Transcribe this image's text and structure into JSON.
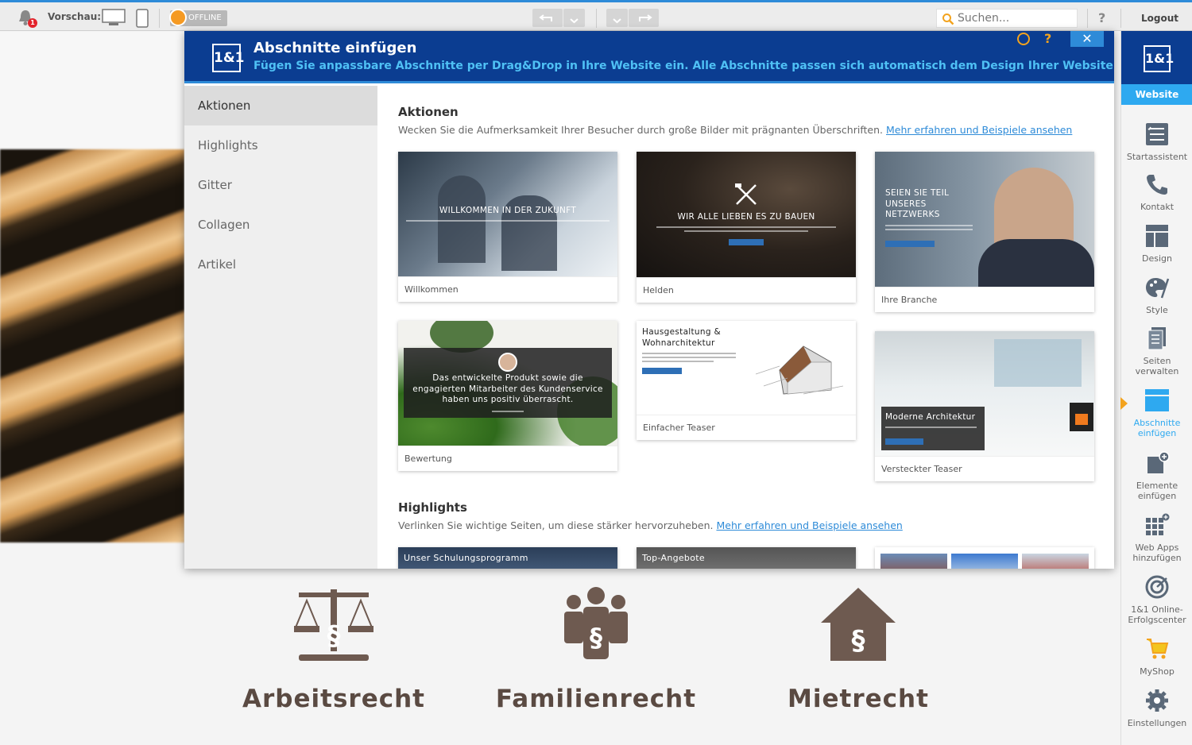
{
  "toolbar": {
    "notification_count": "1",
    "preview_label": "Vorschau:",
    "offline_label": "OFFLINE",
    "search_placeholder": "Suchen...",
    "help_label": "?",
    "logout_label": "Logout"
  },
  "dialog": {
    "logo": "1&1",
    "title": "Abschnitte einfügen",
    "subtitle": "Fügen Sie anpassbare Abschnitte per Drag&Drop in Ihre Website ein. Alle Abschnitte passen sich automatisch dem Design Ihrer Website an.",
    "help_label": "?",
    "close_label": "✕",
    "nav": [
      {
        "label": "Aktionen",
        "active": true
      },
      {
        "label": "Highlights",
        "active": false
      },
      {
        "label": "Gitter",
        "active": false
      },
      {
        "label": "Collagen",
        "active": false
      },
      {
        "label": "Artikel",
        "active": false
      }
    ],
    "sections": [
      {
        "title": "Aktionen",
        "description": "Wecken Sie die Aufmerksamkeit Ihrer Besucher durch große Bilder mit prägnanten Überschriften.",
        "link": "Mehr erfahren und Beispiele ansehen",
        "cards": [
          {
            "label": "Willkommen",
            "thumb_text": "WILLKOMMEN IN DER ZUKUNFT"
          },
          {
            "label": "Helden",
            "thumb_text": "WIR ALLE LIEBEN ES ZU BAUEN"
          },
          {
            "label": "Ihre Branche",
            "thumb_text": "SEIEN SIE TEIL UNSERES NETZWERKS"
          },
          {
            "label": "Bewertung",
            "thumb_text": "Das entwickelte Produkt sowie die engagierten Mitarbeiter des Kundenservice haben uns positiv überrascht."
          },
          {
            "label": "Einfacher Teaser",
            "thumb_text": "Hausgestaltung & Wohnarchitektur"
          },
          {
            "label": "Versteckter Teaser",
            "thumb_text": "Moderne Architektur"
          }
        ]
      },
      {
        "title": "Highlights",
        "description": "Verlinken Sie wichtige Seiten, um diese stärker hervorzuheben.",
        "link": "Mehr erfahren und Beispiele ansehen",
        "cards": [
          {
            "thumb_text": "Unser Schulungsprogramm"
          },
          {
            "thumb_text": "Top-Angebote"
          },
          {
            "thumb_text": ""
          }
        ]
      }
    ]
  },
  "sidebar": {
    "logo": "1&1",
    "website_label": "Website",
    "items": [
      {
        "label": "Startassistent",
        "icon": "wizard-icon"
      },
      {
        "label": "Kontakt",
        "icon": "phone-icon"
      },
      {
        "label": "Design",
        "icon": "layout-icon"
      },
      {
        "label": "Style",
        "icon": "palette-icon"
      },
      {
        "label": "Seiten verwalten",
        "icon": "pages-icon"
      },
      {
        "label": "Abschnitte einfügen",
        "icon": "sections-icon",
        "active": true
      },
      {
        "label": "Elemente einfügen",
        "icon": "elements-icon"
      },
      {
        "label": "Web Apps hinzufügen",
        "icon": "apps-icon"
      },
      {
        "label": "1&1 Online-Erfolgscenter",
        "icon": "analytics-icon"
      },
      {
        "label": "MyShop",
        "icon": "cart-icon"
      },
      {
        "label": "Einstellungen",
        "icon": "gear-icon"
      }
    ]
  },
  "page": {
    "services": [
      {
        "label": "Arbeitsrecht",
        "icon": "scales-icon"
      },
      {
        "label": "Familienrecht",
        "icon": "family-icon"
      },
      {
        "label": "Mietrecht",
        "icon": "house-icon"
      }
    ]
  },
  "colors": {
    "brand_blue": "#0b3d91",
    "accent_blue": "#2ea9f0",
    "accent_orange": "#f3a31e",
    "page_brown": "#6e5a50"
  }
}
